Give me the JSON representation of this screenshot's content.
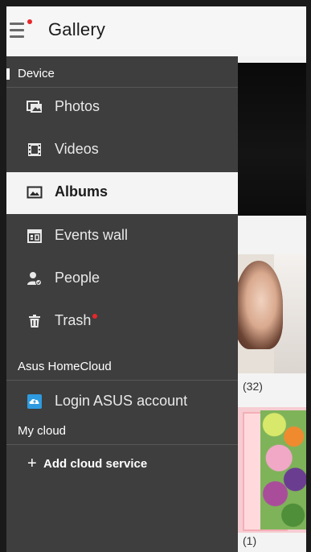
{
  "app": {
    "title": "Gallery"
  },
  "drawer": {
    "sections": {
      "device": "Device",
      "homecloud": "Asus HomeCloud",
      "mycloud": "My cloud"
    },
    "items": {
      "photos": "Photos",
      "videos": "Videos",
      "albums": "Albums",
      "events": "Events wall",
      "people": "People",
      "trash": "Trash",
      "login": "Login ASUS account"
    },
    "selected_item": "Albums",
    "add_cloud": {
      "plus": "+",
      "label": "Add cloud service"
    }
  },
  "albums": [
    {
      "count": ""
    },
    {
      "count": "(32)"
    },
    {
      "count": "(1)"
    }
  ],
  "icons": {
    "menu": "hamburger-menu-icon",
    "photos": "photos-icon",
    "videos": "film-icon",
    "albums": "album-icon",
    "events": "calendar-icon",
    "people": "person-icon",
    "trash": "trash-icon",
    "login": "cloud-upload-icon"
  },
  "colors": {
    "drawer_bg": "#3e3e3e",
    "selected_bg": "#f4f4f4",
    "notification_dot": "#e8272b",
    "login_icon": "#2e9be0"
  }
}
